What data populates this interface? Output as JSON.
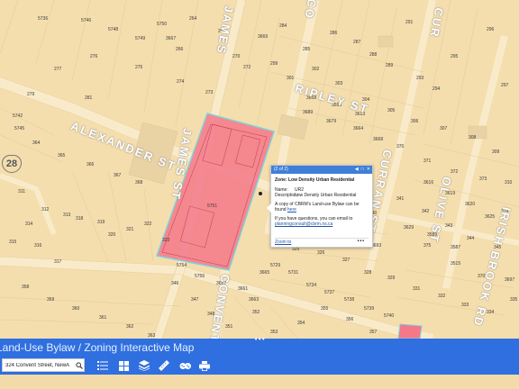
{
  "map": {
    "route_badge": "28",
    "streets": [
      {
        "id": "alexander",
        "text": "ALEXANDER ST"
      },
      {
        "id": "james_top",
        "text": "JAMES"
      },
      {
        "id": "james_mid",
        "text": "JAMES ST"
      },
      {
        "id": "ripley",
        "text": "RIPLEY ST"
      },
      {
        "id": "curran",
        "text": "CURRAN ST"
      },
      {
        "id": "olive",
        "text": "OLIVE ST"
      },
      {
        "id": "irish",
        "text": "IRISH BROOK RD"
      },
      {
        "id": "convent",
        "text": "CONVENT S"
      },
      {
        "id": "co_top",
        "text": "CO"
      },
      {
        "id": "cur_top",
        "text": "CUR"
      }
    ],
    "lot_numbers": [
      "5736",
      "264",
      "268",
      "266",
      "270",
      "272",
      "273",
      "274",
      "275",
      "276",
      "277",
      "279",
      "281",
      "284",
      "285",
      "286",
      "287",
      "288",
      "289",
      "291",
      "293",
      "294",
      "295",
      "296",
      "297",
      "299",
      "301",
      "302",
      "303",
      "304",
      "305",
      "306",
      "307",
      "308",
      "309",
      "310",
      "311",
      "312",
      "313",
      "314",
      "315",
      "316",
      "317",
      "318",
      "319",
      "320",
      "321",
      "322",
      "323",
      "325",
      "326",
      "327",
      "328",
      "329",
      "331",
      "332",
      "333",
      "334",
      "335",
      "336",
      "337",
      "338",
      "339",
      "340",
      "341",
      "342",
      "343",
      "344",
      "345",
      "346",
      "347",
      "348",
      "351",
      "352",
      "353",
      "354",
      "355",
      "356",
      "357",
      "358",
      "359",
      "360",
      "361",
      "362",
      "363",
      "364",
      "365",
      "366",
      "367",
      "368",
      "370",
      "371",
      "372",
      "373",
      "374",
      "375",
      "3515",
      "3707",
      "3697",
      "3693",
      "3689",
      "3679",
      "3664",
      "3668",
      "3658",
      "3599",
      "3613",
      "3605",
      "3608",
      "3611",
      "3614",
      "3616",
      "3619",
      "3620",
      "3625",
      "3629",
      "3589",
      "3587",
      "5729",
      "5731",
      "5734",
      "5737",
      "5738",
      "5739",
      "5740",
      "5742",
      "5745",
      "5746",
      "5748",
      "5749",
      "5750",
      "5751",
      "5754",
      "5756",
      "3657",
      "3661",
      "3663",
      "3665",
      "3667",
      "3669"
    ]
  },
  "popup": {
    "counter": "(2 of 2)",
    "title": "Zone: Low Density Urban Residential",
    "name_key": "Name:",
    "name_value": "UR2",
    "desc_key": "Description:",
    "desc_value": "Low Density Urban Residential",
    "bylaw_text": "A copy of CBRM's Land-use Bylaw can be found",
    "bylaw_link": "here",
    "questions_text": "If you have questions, you can email to",
    "email_link": "planningconsult@cbrm.ns.ca",
    "zoom_link": "Zoom to",
    "more": "•••"
  },
  "app": {
    "title": "Land-Use Bylaw / Zoning Interactive Map",
    "grip": "•••"
  },
  "toolbar": {
    "search_value": "324 Convent Street, NewÀ",
    "tools": [
      "search-icon",
      "list-icon",
      "basemap-gallery-icon",
      "layers-icon",
      "measure-icon",
      "print-friends-icon",
      "print-icon"
    ]
  },
  "colors": {
    "map_bg": "#f4deae",
    "road": "#f9e9c6",
    "zone_fill": "#f4788a",
    "zone_border": "#7fd2dc",
    "toolbar": "#2f6fe0",
    "popup_header": "#3f7fd7"
  }
}
